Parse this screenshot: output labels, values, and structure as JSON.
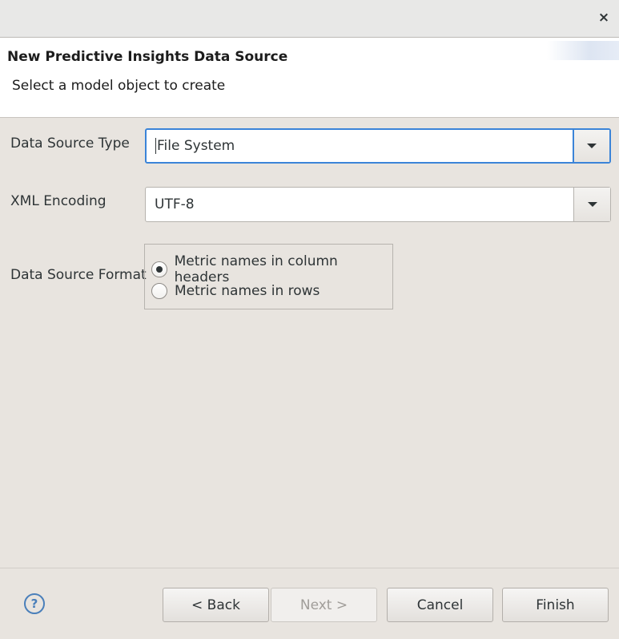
{
  "window": {
    "close_glyph": "×",
    "close_icon": "close-icon"
  },
  "header": {
    "title": "New Predictive Insights Data Source",
    "description": "Select a model object to create"
  },
  "form": {
    "data_source_type": {
      "label": "Data Source Type",
      "value": "File System",
      "icon": "chevron-down-icon"
    },
    "xml_encoding": {
      "label": "XML Encoding",
      "value": "UTF-8",
      "icon": "chevron-down-icon"
    },
    "data_source_format": {
      "label": "Data Source Format",
      "options": [
        {
          "label": "Metric names in column headers",
          "selected": true
        },
        {
          "label": "Metric names in rows",
          "selected": false
        }
      ]
    }
  },
  "footer": {
    "help_glyph": "?",
    "help_icon": "help-icon",
    "back_label": "< Back",
    "next_label": "Next >",
    "next_enabled": false,
    "cancel_label": "Cancel",
    "finish_label": "Finish"
  },
  "colors": {
    "focus_border": "#3b84d8",
    "window_bg": "#e8e4df",
    "header_bg": "#ffffff",
    "help_icon": "#4a7fba"
  }
}
